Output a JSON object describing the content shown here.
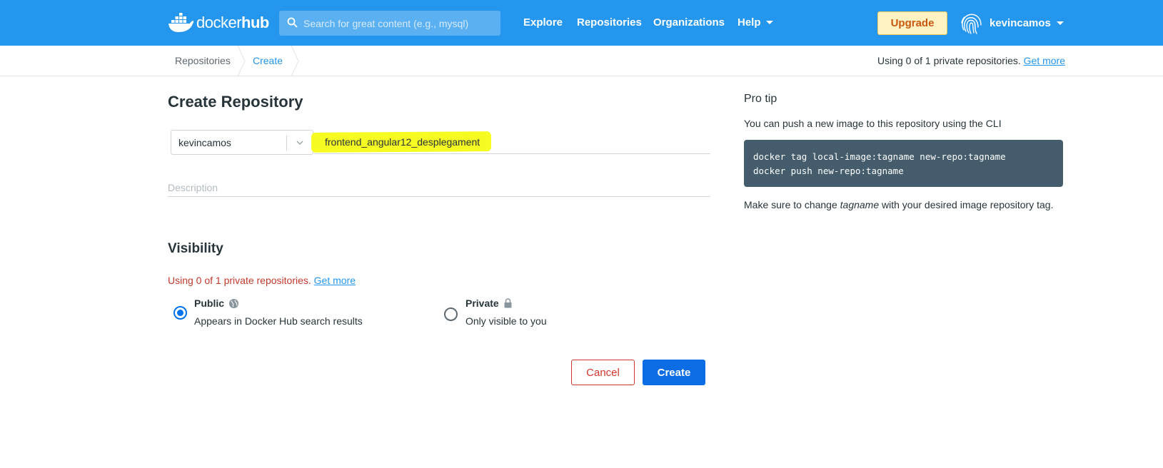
{
  "header": {
    "logo_word_docker": "docker",
    "logo_word_hub": "hub",
    "search_placeholder": "Search for great content (e.g., mysql)",
    "nav": {
      "explore": "Explore",
      "repositories": "Repositories",
      "organizations": "Organizations",
      "help": "Help"
    },
    "upgrade_label": "Upgrade",
    "username": "kevincamos"
  },
  "breadcrumb": {
    "items": [
      "Repositories",
      "Create"
    ],
    "usage_text": "Using 0 of 1 private repositories.",
    "usage_link": "Get more"
  },
  "form": {
    "title": "Create Repository",
    "namespace": "kevincamos",
    "repo_name": "frontend_angular12_desplegament",
    "description_placeholder": "Description",
    "visibility_title": "Visibility",
    "usage_text": "Using 0 of 1 private repositories.",
    "usage_link": "Get more",
    "options": [
      {
        "title": "Public",
        "desc": "Appears in Docker Hub search results",
        "selected": true,
        "icon": "globe-icon"
      },
      {
        "title": "Private",
        "desc": "Only visible to you",
        "selected": false,
        "icon": "lock-icon"
      }
    ],
    "cancel_label": "Cancel",
    "create_label": "Create"
  },
  "protip": {
    "title": "Pro tip",
    "intro": "You can push a new image to this repository using the CLI",
    "code": [
      "docker tag local-image:tagname new-repo:tagname",
      "docker push new-repo:tagname"
    ],
    "note_before": "Make sure to change ",
    "note_em": "tagname",
    "note_after": " with your desired image repository tag."
  },
  "colors": {
    "brand_blue": "#2496ed",
    "highlight_yellow": "#f6fb22",
    "warning_red": "#c0392b",
    "primary_button": "#0b6ce3",
    "code_background": "#445c6b"
  }
}
